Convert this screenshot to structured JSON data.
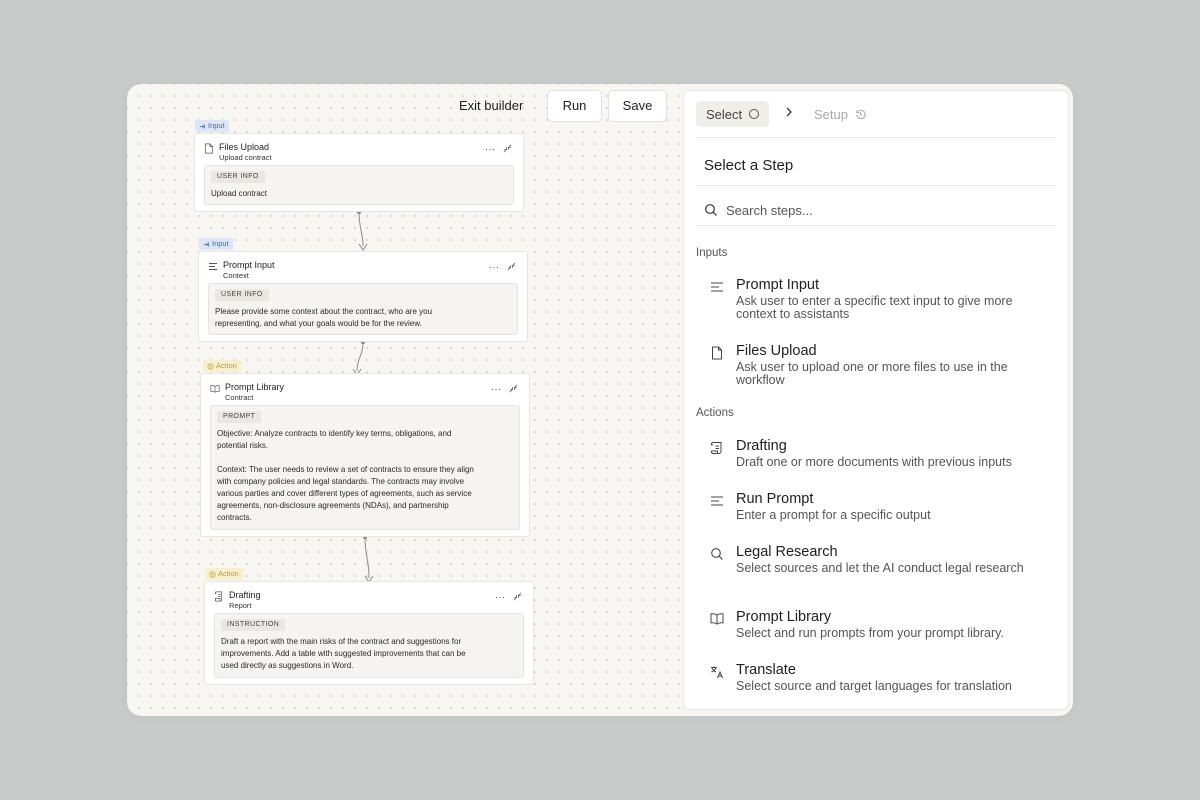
{
  "toolbar": {
    "exit_label": "Exit builder",
    "run_label": "Run",
    "save_label": "Save"
  },
  "nodes": [
    {
      "tag": "Input",
      "title": "Files Upload",
      "subtitle": "Upload contract",
      "chip": "USER INFO",
      "body": "Upload contract",
      "icon": "file-icon"
    },
    {
      "tag": "Input",
      "title": "Prompt Input",
      "subtitle": "Context",
      "chip": "USER INFO",
      "body_lines": [
        "Please provide some context about the contract, who are you",
        "representing, and what your goals would be for the review."
      ],
      "icon": "text-lines-icon"
    },
    {
      "tag": "Action",
      "title": "Prompt Library",
      "subtitle": "Contract",
      "chip": "PROMPT",
      "body_lines": [
        "Objective: Analyze contracts to identify key terms, obligations, and",
        "potential risks.",
        "",
        "Context: The user needs to review a set of contracts to ensure they align",
        "with company policies and legal standards. The contracts may involve",
        "various parties and cover different types of agreements, such as service",
        "agreements, non-disclosure agreements (NDAs), and partnership",
        "contracts."
      ],
      "icon": "book-icon"
    },
    {
      "tag": "Action",
      "title": "Drafting",
      "subtitle": "Report",
      "chip": "INSTRUCTION",
      "body_lines": [
        "Draft a report with the main risks of the contract and suggestions for",
        "improvements. Add a table with suggested improvements that can be",
        "used directly as suggestions in Word."
      ],
      "icon": "scroll-icon"
    }
  ],
  "panel": {
    "steps_nav": {
      "select_label": "Select",
      "setup_label": "Setup"
    },
    "title": "Select a Step",
    "search_placeholder": "Search steps...",
    "sections": [
      {
        "label": "Inputs",
        "items": [
          {
            "name": "Prompt Input",
            "desc": "Ask user to enter a specific text input to give more context to assistants",
            "icon": "text-lines-icon"
          },
          {
            "name": "Files Upload",
            "desc": "Ask user to upload one or more files to use in the workflow",
            "icon": "file-icon"
          }
        ]
      },
      {
        "label": "Actions",
        "items": [
          {
            "name": "Drafting",
            "desc": "Draft one or more documents with previous inputs",
            "icon": "scroll-icon"
          },
          {
            "name": "Run Prompt",
            "desc": "Enter a prompt for a specific output",
            "icon": "text-lines-icon"
          },
          {
            "name": "Legal Research",
            "desc": "Select sources and let the AI conduct legal research",
            "icon": "search-icon"
          },
          {
            "name": "Prompt Library",
            "desc": "Select and run prompts from your prompt library.",
            "icon": "book-icon"
          },
          {
            "name": "Translate",
            "desc": "Select source and target languages for translation",
            "icon": "translate-icon"
          }
        ]
      }
    ]
  }
}
